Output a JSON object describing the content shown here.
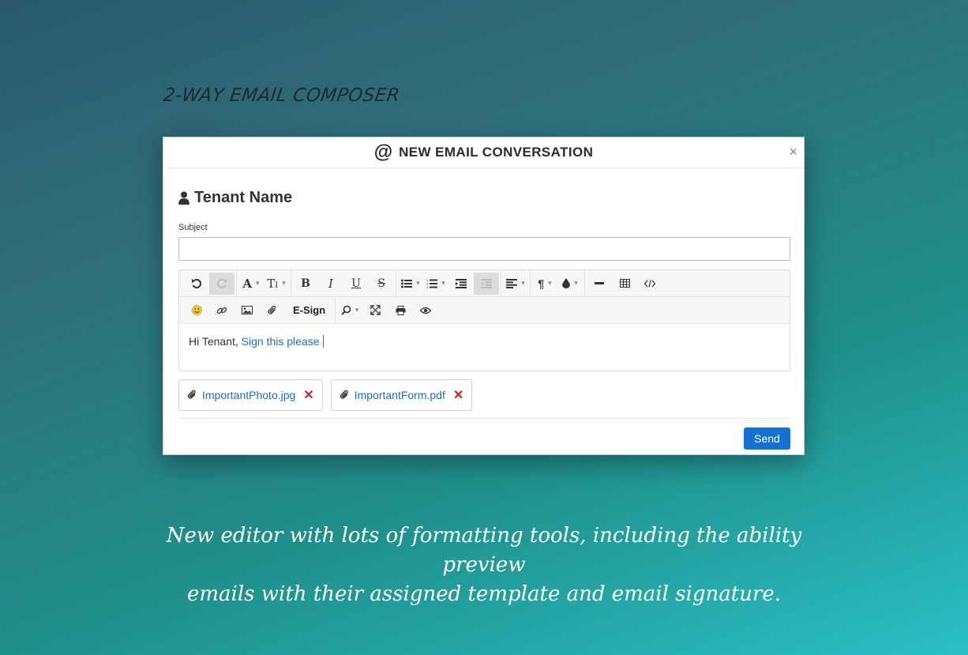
{
  "page": {
    "heading": "2-WAY EMAIL COMPOSER",
    "caption_line1": "New editor with lots of formatting tools, including the ability preview",
    "caption_line2": "emails with their assigned template and email signature."
  },
  "modal": {
    "title": "NEW EMAIL CONVERSATION",
    "title_icon": "at-icon",
    "close_label": "×",
    "recipient_name": "Tenant Name",
    "recipient_icon": "user-icon",
    "subject_label": "Subject",
    "subject_value": "",
    "esign_label": "E-Sign",
    "body_greeting": "Hi Tenant,",
    "body_link": "Sign this please",
    "attachments": [
      {
        "name": "ImportantPhoto.jpg",
        "icon": "paperclip-icon"
      },
      {
        "name": "ImportantForm.pdf",
        "icon": "paperclip-icon"
      }
    ],
    "remove_label": "✕",
    "send_label": "Send"
  },
  "toolbar_icons": [
    "undo-icon",
    "redo-icon",
    "font-color-icon",
    "font-size-icon",
    "bold-icon",
    "italic-icon",
    "underline-icon",
    "strikethrough-icon",
    "bulleted-list-icon",
    "numbered-list-icon",
    "indent-icon",
    "outdent-icon",
    "align-icon",
    "paragraph-icon",
    "fill-color-icon",
    "horizontal-rule-icon",
    "table-icon",
    "code-view-icon",
    "emoji-icon",
    "link-icon",
    "image-icon",
    "attach-icon",
    "search-icon",
    "fullscreen-icon",
    "print-icon",
    "preview-icon"
  ],
  "colors": {
    "accent": "#1771d4",
    "link": "#1f6fb6",
    "remove": "#d51f1f",
    "text": "#333333"
  }
}
